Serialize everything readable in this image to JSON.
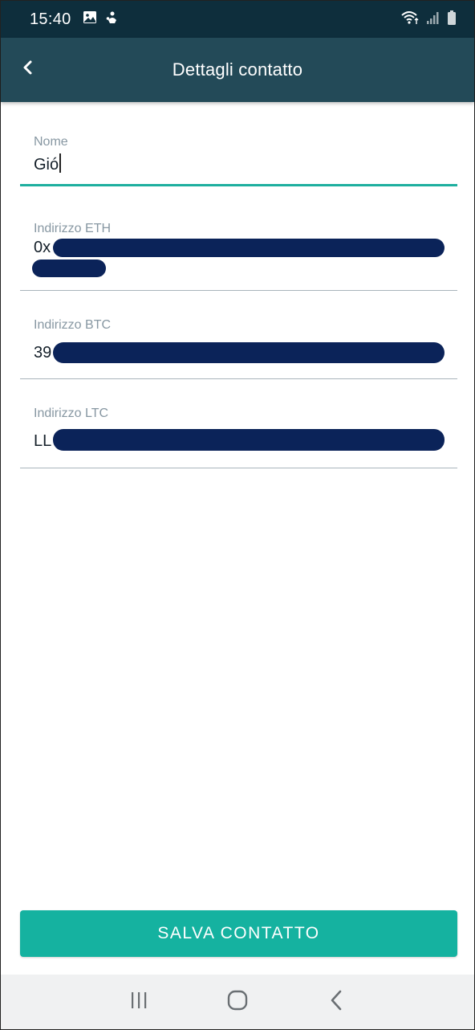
{
  "status_bar": {
    "time": "15:40",
    "left_icons": [
      "image-icon",
      "app-notification-icon"
    ],
    "right_icons": [
      "wifi-icon",
      "signal-icon",
      "battery-icon"
    ]
  },
  "header": {
    "title": "Dettagli contatto",
    "back_icon": "chevron-left-icon"
  },
  "form": {
    "name": {
      "label": "Nome",
      "value": "Gió"
    },
    "eth": {
      "label": "Indirizzo ETH",
      "value_prefix": "0x"
    },
    "btc": {
      "label": "Indirizzo BTC",
      "value_prefix": "39"
    },
    "ltc": {
      "label": "Indirizzo LTC",
      "value_prefix": "LL"
    }
  },
  "actions": {
    "save_label": "SALVA CONTATTO"
  },
  "nav_bar": {
    "icons": [
      "recent-apps-icon",
      "home-icon",
      "back-icon"
    ]
  },
  "colors": {
    "status_bar": "#0e2e3c",
    "app_bar": "#234a58",
    "accent": "#15b2a0",
    "redaction": "#0b2359"
  }
}
